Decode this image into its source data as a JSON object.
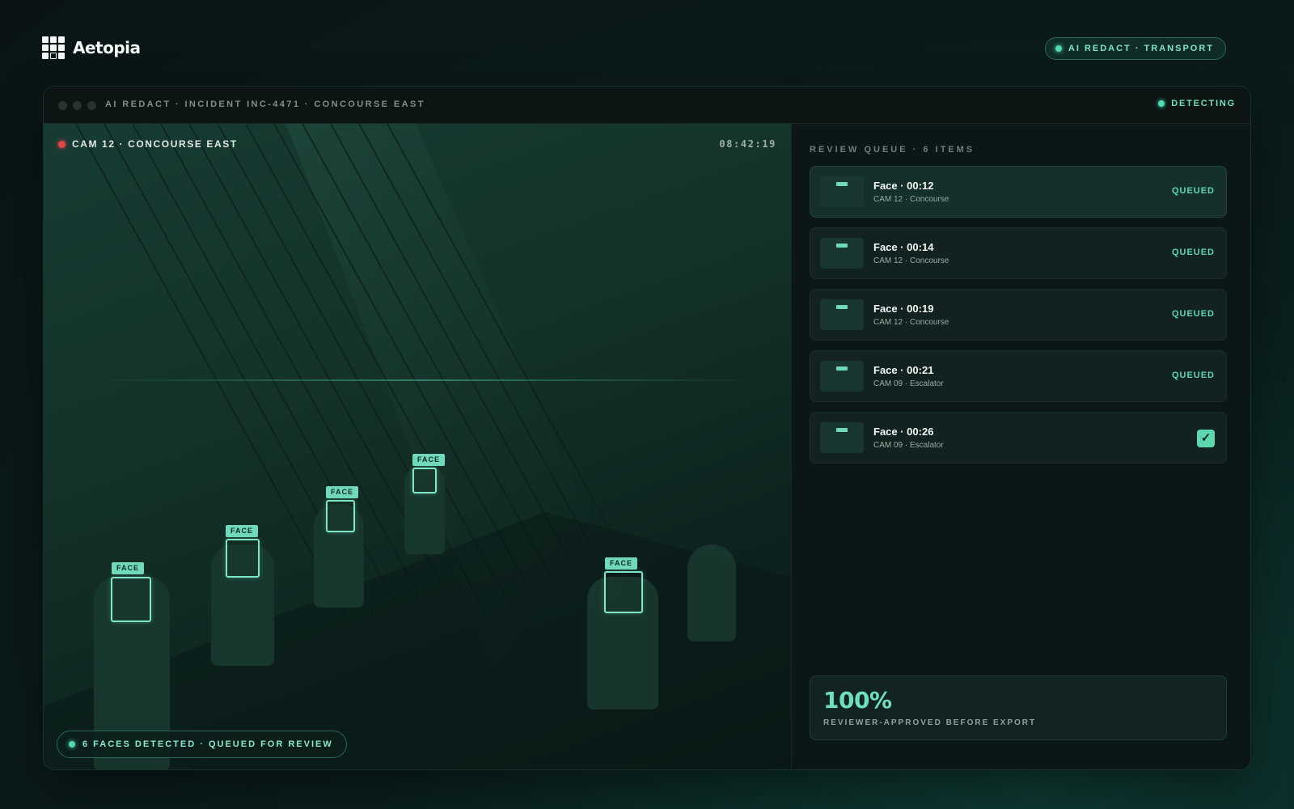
{
  "brand": {
    "name": "Aetopia",
    "logo_icon": "grid-logo-icon"
  },
  "top_pill": {
    "label": "AI REDACT · TRANSPORT"
  },
  "window": {
    "title": "AI REDACT · INCIDENT INC-4471 · CONCOURSE EAST",
    "status": "DETECTING"
  },
  "video": {
    "camera_label": "CAM 12 · CONCOURSE EAST",
    "timecode": "08:42:19",
    "face_tag": "FACE",
    "detections_summary": "6 FACES DETECTED · QUEUED FOR REVIEW"
  },
  "queue": {
    "title": "REVIEW QUEUE · 6 ITEMS",
    "items": [
      {
        "name": "Face · 00:12",
        "source": "CAM 12 · Concourse",
        "status": "QUEUED"
      },
      {
        "name": "Face · 00:14",
        "source": "CAM 12 · Concourse",
        "status": "QUEUED"
      },
      {
        "name": "Face · 00:19",
        "source": "CAM 12 · Concourse",
        "status": "QUEUED"
      },
      {
        "name": "Face · 00:21",
        "source": "CAM 09 · Escalator",
        "status": "QUEUED"
      },
      {
        "name": "Face · 00:26",
        "source": "CAM 09 · Escalator",
        "status": "approved"
      }
    ]
  },
  "stat": {
    "value": "100%",
    "label": "REVIEWER-APPROVED BEFORE EXPORT"
  },
  "colors": {
    "accent": "#6fe0bf",
    "rec": "#e0474a",
    "background": "#0a1414"
  }
}
